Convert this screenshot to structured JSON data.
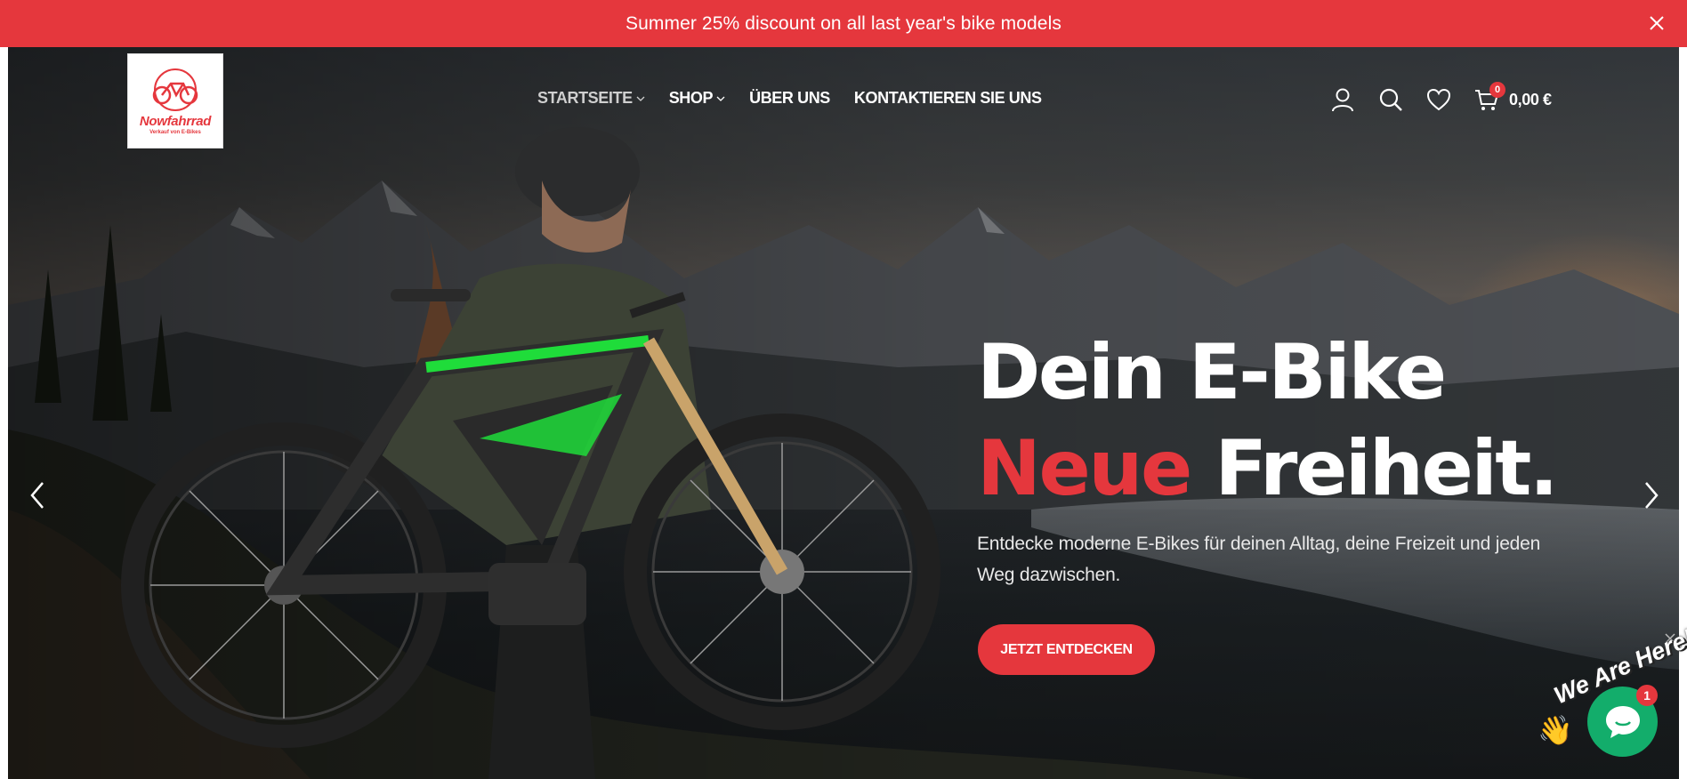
{
  "announcement": {
    "text": "Summer 25% discount on all last year's bike models"
  },
  "logo": {
    "name": "Nowfahrrad",
    "tagline": "Verkauf von E-Bikes"
  },
  "nav": {
    "items": [
      {
        "label": "STARTSEITE",
        "has_dropdown": true,
        "active": true
      },
      {
        "label": "SHOP",
        "has_dropdown": true,
        "active": false
      },
      {
        "label": "ÜBER UNS",
        "has_dropdown": false,
        "active": false
      },
      {
        "label": "KONTAKTIEREN SIE UNS",
        "has_dropdown": false,
        "active": false
      }
    ]
  },
  "header_icons": [
    "user-icon",
    "search-icon",
    "heart-icon",
    "cart-icon"
  ],
  "cart": {
    "count": "0",
    "total": "0,00 €"
  },
  "hero": {
    "headline_line1": "Dein E-Bike",
    "headline_accent": "Neue",
    "headline_rest": "Freiheit.",
    "subtext": "Entdecke moderne E-Bikes für deinen Alltag, deine Freizeit und jeden Weg dazwischen.",
    "cta_label": "JETZT ENTDECKEN"
  },
  "chat": {
    "tag": "We Are Here!",
    "unread": "1"
  },
  "colors": {
    "brand_red": "#e5373d",
    "chat_green": "#13ad6b",
    "bike_green": "#1fdc3a"
  }
}
